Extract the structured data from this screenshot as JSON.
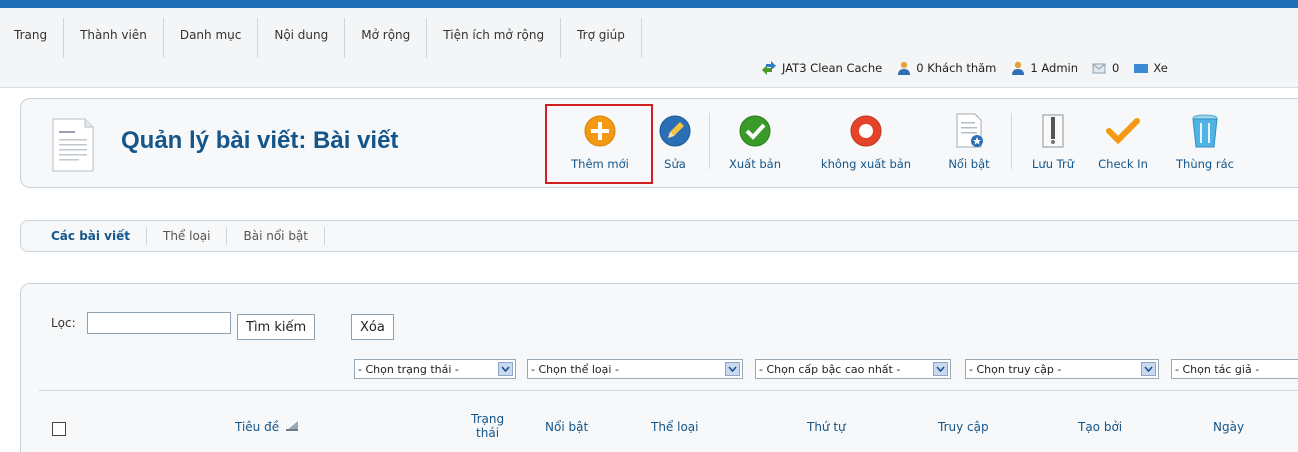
{
  "menu": [
    "Trang",
    "Thành viên",
    "Danh mục",
    "Nội dung",
    "Mở rộng",
    "Tiện ích mở rộng",
    "Trợ giúp"
  ],
  "status": {
    "cache": "JAT3 Clean Cache",
    "visitors": "0 Khách thăm",
    "admins": "1 Admin",
    "messages": "0",
    "view_site": "Xe"
  },
  "page": {
    "title": "Quản lý bài viết: Bài viết"
  },
  "toolbar": {
    "new": "Thêm mới",
    "edit": "Sửa",
    "publish": "Xuất bản",
    "unpublish": "không xuất bản",
    "featured": "Nổi bật",
    "archive": "Lưu Trữ",
    "checkin": "Check In",
    "trash": "Thùng rác"
  },
  "subnav": [
    "Các bài viết",
    "Thể loại",
    "Bài nổi bật"
  ],
  "filter": {
    "label": "Lọc:",
    "value": "",
    "search": "Tìm kiếm",
    "clear": "Xóa",
    "selects": [
      "- Chọn trạng thái -",
      "- Chọn thể loại -",
      "- Chọn cấp bậc cao nhất -",
      "- Chọn truy cập -",
      "- Chọn tác giả -"
    ]
  },
  "table": {
    "headers": {
      "title": "Tiêu đề",
      "status_line1": "Trạng",
      "status_line2": "thái",
      "featured": "Nổi bật",
      "category": "Thể loại",
      "order": "Thứ tự",
      "access": "Truy cập",
      "created_by": "Tạo bởi",
      "date": "Ngày"
    }
  },
  "colors": {
    "accent_blue": "#1e6fb5",
    "title_blue": "#14558a",
    "highlight_red": "#d21e1e",
    "new_orange": "#f39a12",
    "publish_green": "#3a9a2a",
    "unpublish_red": "#e4442a"
  }
}
